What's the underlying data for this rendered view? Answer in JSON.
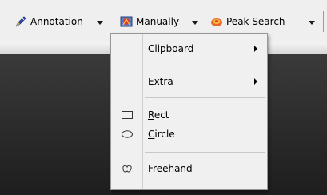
{
  "toolbar": {
    "annotation": {
      "label": "Annotation",
      "icon": "pen-icon"
    },
    "manually": {
      "label": "Manually",
      "icon": "manual-draw-icon"
    },
    "peak_search": {
      "label": "Peak Search",
      "icon": "peak-search-icon"
    }
  },
  "menu": {
    "items": [
      {
        "label": "Clipboard",
        "has_submenu": true
      },
      {
        "label": "Extra",
        "has_submenu": true
      },
      {
        "label_rest": "ect",
        "mnemonic": "R",
        "icon": "rectangle-icon"
      },
      {
        "label_rest": "ircle",
        "mnemonic": "C",
        "icon": "ellipse-icon"
      },
      {
        "label_rest": "reehand",
        "mnemonic": "F",
        "icon": "freehand-icon"
      }
    ]
  },
  "colors": {
    "workspace_dark": "#1e1e1e",
    "menu_bg": "#f0f0f0",
    "toolbar_bg": "#efefef"
  }
}
